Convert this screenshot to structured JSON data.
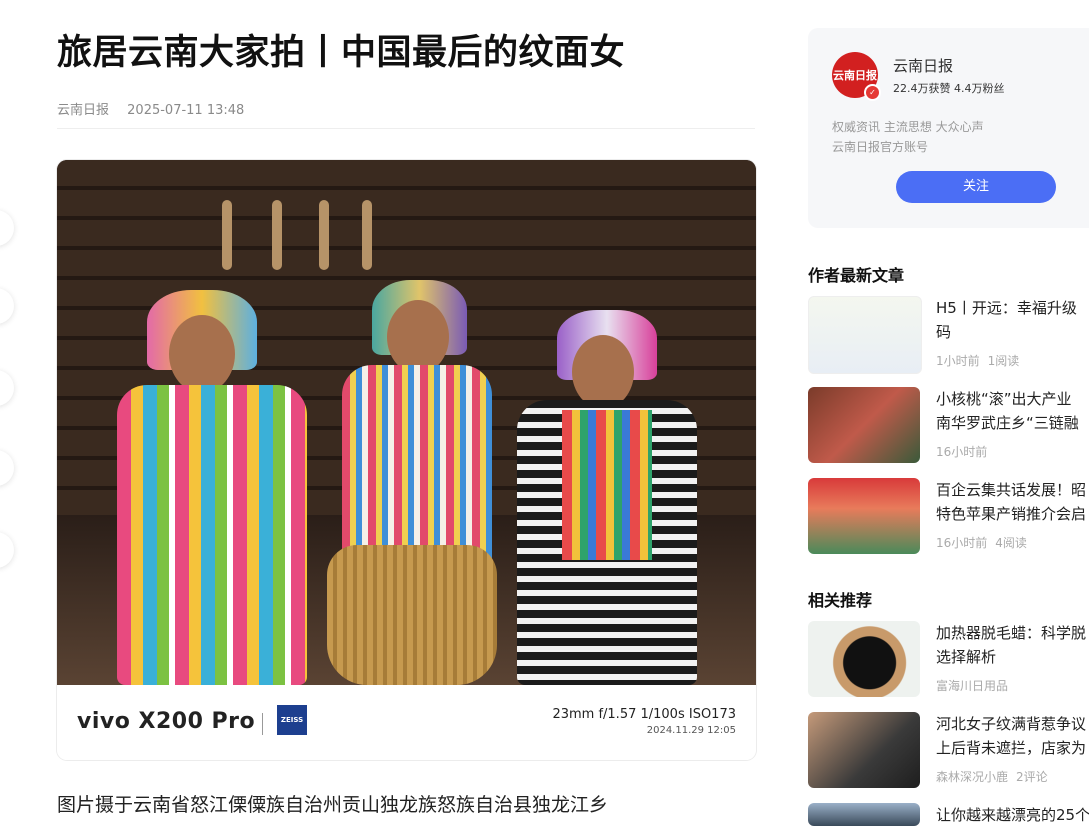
{
  "article": {
    "title": "旅居云南大家拍丨中国最后的纹面女",
    "source": "云南日报",
    "datetime": "2025-07-11 13:48",
    "caption": "图片摄于云南省怒江傈僳族自治州贡山独龙族怒族自治县独龙江乡"
  },
  "photo": {
    "camera_model": "vivo X200 Pro",
    "brand_badge": "ZEISS",
    "params": "23mm  f/1.57  1/100s  ISO173",
    "date": "2024.11.29 12:05"
  },
  "author": {
    "name": "云南日报",
    "stats": "22.4万获赞 4.4万粉丝",
    "desc_line1": "权威资讯 主流思想 大众心声",
    "desc_line2": "云南日报官方账号",
    "follow_label": "关注",
    "avatar_text": "云南日报"
  },
  "latest": {
    "heading": "作者最新文章",
    "items": [
      {
        "line1": "H5丨开远：幸福升级",
        "line2": "码",
        "time": "1小时前",
        "reads": "1阅读"
      },
      {
        "line1": "小核桃“滚”出大产业",
        "line2": "南华罗武庄乡“三链融",
        "time": "16小时前",
        "reads": ""
      },
      {
        "line1": "百企云集共话发展！昭",
        "line2": "特色苹果产销推介会启",
        "time": "16小时前",
        "reads": "4阅读"
      }
    ]
  },
  "related": {
    "heading": "相关推荐",
    "items": [
      {
        "line1": "加热器脱毛蜡：科学脱",
        "line2": "选择解析",
        "source": "富海川日用品",
        "extra": ""
      },
      {
        "line1": "河北女子纹满背惹争议",
        "line2": "上后背未遮拦，店家为",
        "source": "森林深况小鹿",
        "extra": "2评论"
      },
      {
        "line1": "让你越来越漂亮的25个",
        "line2": "",
        "source": "",
        "extra": ""
      }
    ]
  },
  "colors": {
    "accent": "#4b6ef5",
    "brand_red": "#d22020"
  }
}
